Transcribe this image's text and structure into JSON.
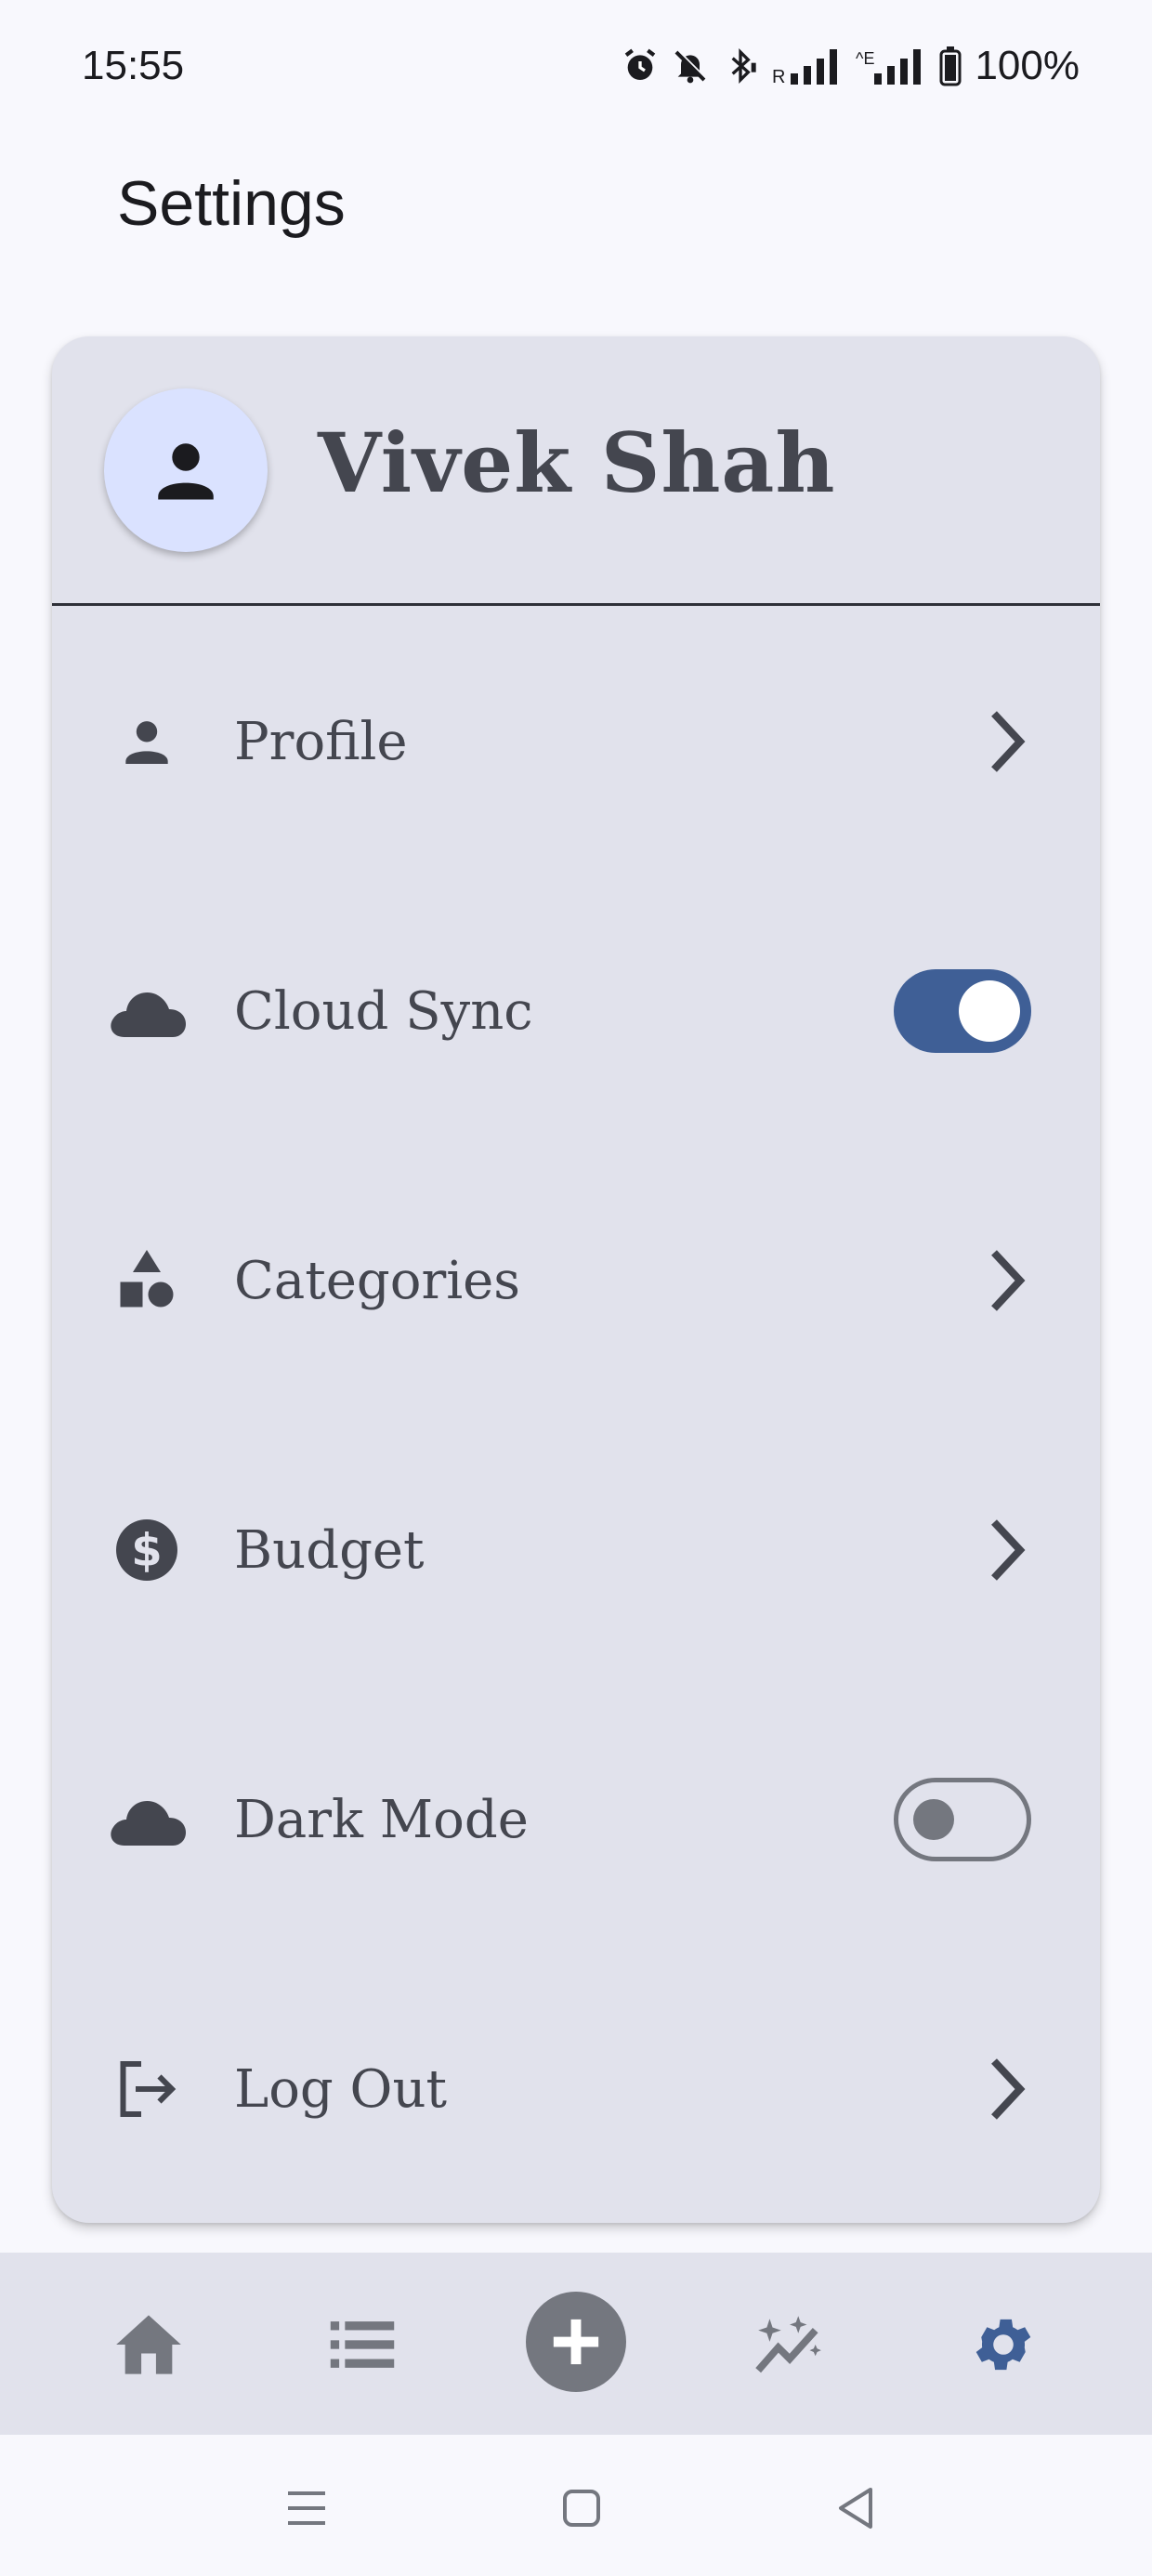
{
  "status_bar": {
    "time": "15:55",
    "battery": "100%",
    "icons": [
      "alarm-icon",
      "mute-icon",
      "bluetooth-icon",
      "signal-r-icon",
      "signal-e-icon",
      "battery-icon"
    ]
  },
  "header": {
    "title": "Settings"
  },
  "profile": {
    "name": "Vivek  Shah",
    "avatar_icon": "person-icon"
  },
  "settings": {
    "items": [
      {
        "label": "Profile",
        "icon": "person-icon",
        "control": "chevron"
      },
      {
        "label": "Cloud Sync",
        "icon": "cloud-icon",
        "control": "toggle",
        "value": true
      },
      {
        "label": "Categories",
        "icon": "shapes-icon",
        "control": "chevron"
      },
      {
        "label": "Budget",
        "icon": "dollar-icon",
        "control": "chevron"
      },
      {
        "label": "Dark Mode",
        "icon": "cloud-icon",
        "control": "toggle",
        "value": false
      },
      {
        "label": "Log Out",
        "icon": "logout-icon",
        "control": "chevron"
      }
    ]
  },
  "bottom_nav": {
    "items": [
      "home-icon",
      "list-icon",
      "add-icon",
      "insights-icon",
      "settings-icon"
    ],
    "active": "settings-icon"
  },
  "colors": {
    "accent": "#3f5f96",
    "card": "#e1e2ec",
    "text": "#44464f",
    "background": "#f8f8fd",
    "avatar_bg": "#dae2ff"
  }
}
